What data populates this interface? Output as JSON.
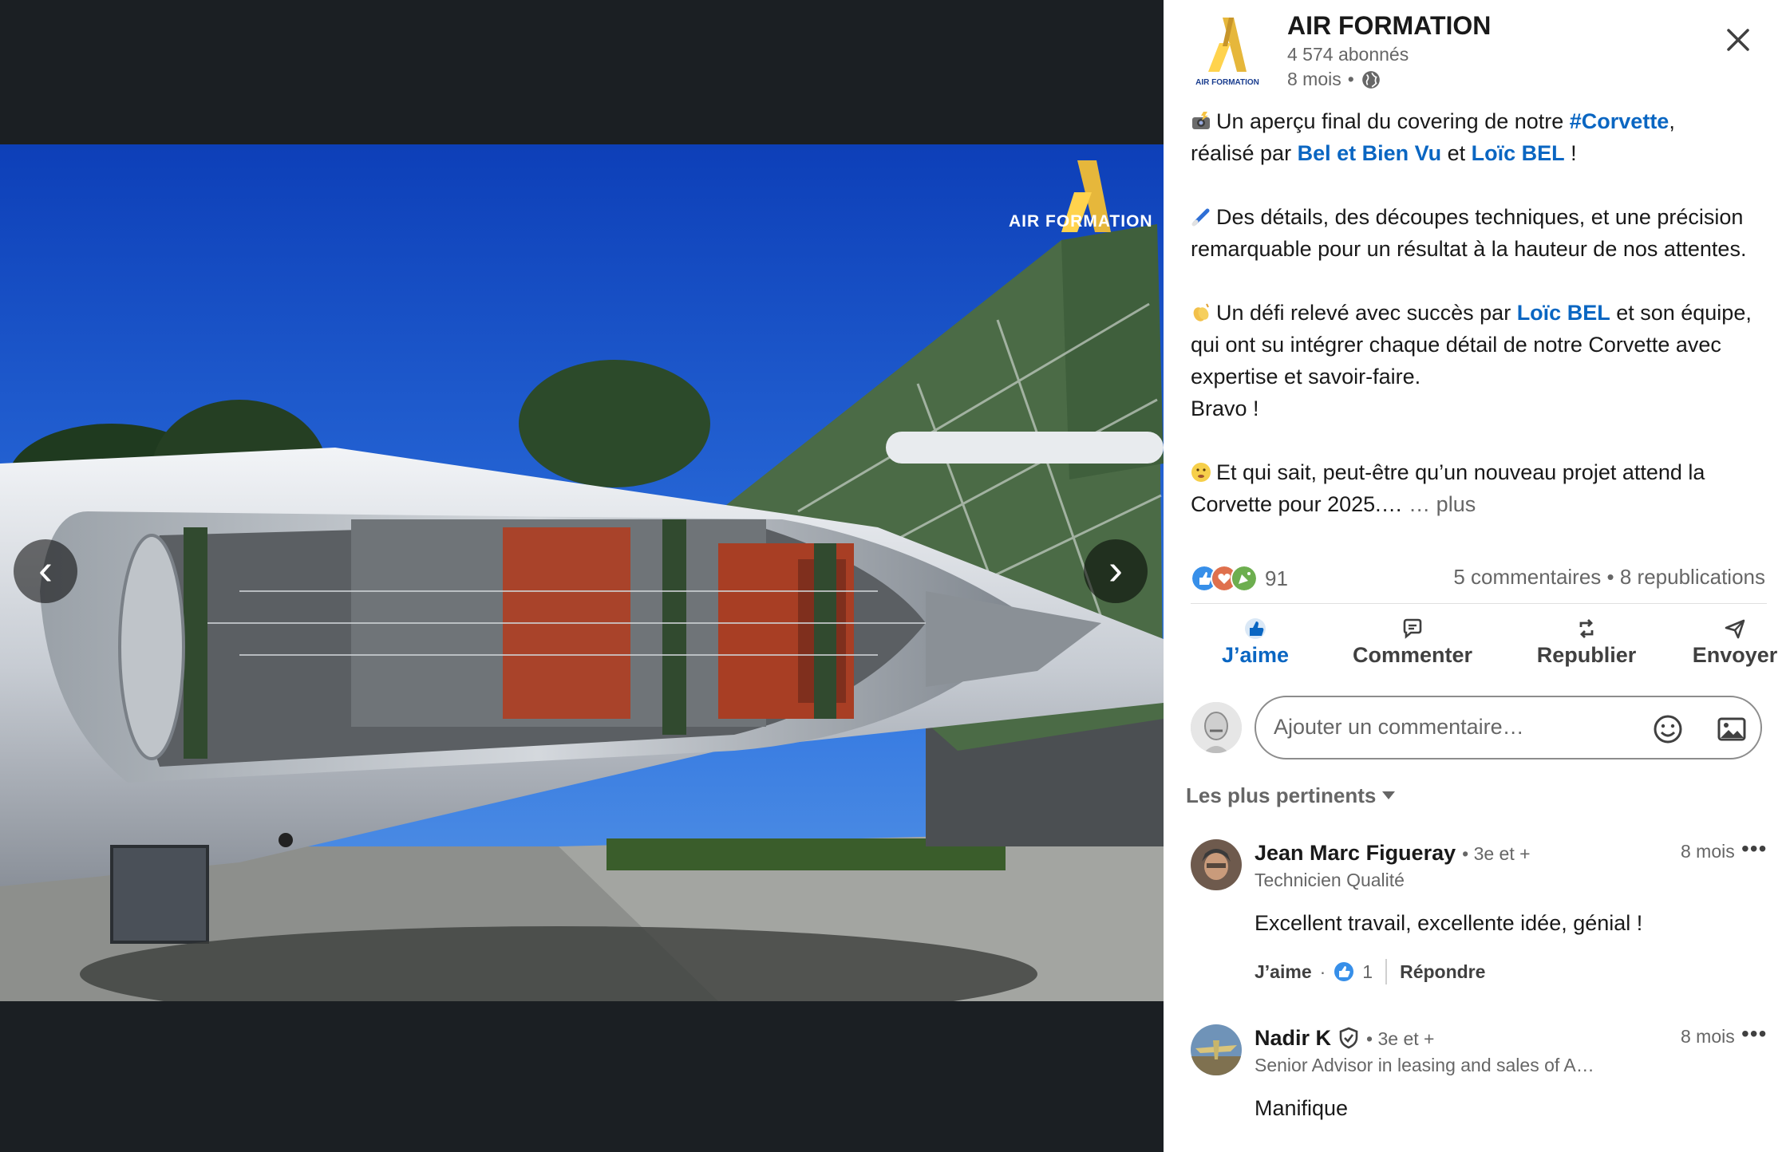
{
  "viewer": {
    "watermark": "AIR FORMATION",
    "prev_label": "‹",
    "next_label": "›"
  },
  "post": {
    "org_name": "AIR FORMATION",
    "logo_caption": "AIR FORMATION",
    "followers": "4 574 abonnés",
    "time": "8 mois",
    "dot": "•",
    "paragraphs": {
      "p1": {
        "t1": "Un aperçu final du covering de notre ",
        "tag": "#Corvette",
        "t2": ",",
        "t3": "réalisé par ",
        "mention1": "Bel et Bien Vu",
        "t4": " et ",
        "mention2": "Loïc BEL",
        "t5": " !"
      },
      "p2": "Des détails, des découpes techniques, et une précision remarquable pour un résultat à la hauteur de nos attentes.",
      "p3": {
        "t1": "Un défi relevé avec succès par ",
        "mention": "Loïc BEL",
        "t2": " et son équipe, qui ont su intégrer chaque détail de notre Corvette avec expertise et savoir-faire.",
        "t3": "Bravo !"
      },
      "p4": {
        "t1": "Et qui sait, peut-être qu’un nouveau projet attend la Corvette pour 2025.…",
        "more": "… plus"
      }
    },
    "reaction_count": "91",
    "comments_count": "5 commentaires",
    "separator": " • ",
    "reposts_count": "8 republications"
  },
  "actions": {
    "like": "J’aime",
    "comment": "Commenter",
    "repost": "Republier",
    "send": "Envoyer"
  },
  "comment_box": {
    "placeholder": "Ajouter un commentaire…"
  },
  "sort_label": "Les plus pertinents",
  "comments": [
    {
      "name": "Jean Marc Figueray",
      "degree": "• 3e et +",
      "headline": "Technicien Qualité",
      "time": "8 mois",
      "dots": "•••",
      "text": "Excellent travail, excellente idée, génial !",
      "like": "J’aime",
      "dot": "·",
      "likes": "1",
      "reply": "Répondre"
    },
    {
      "name": "Nadir K",
      "degree": "• 3e et +",
      "headline": "Senior Advisor in leasing and sales of A…",
      "time": "8 mois",
      "dots": "•••",
      "text": "Manifique"
    }
  ],
  "colors": {
    "accent": "#0a66c2",
    "viewer_bg": "#1b1f23",
    "muted": "#666666"
  }
}
